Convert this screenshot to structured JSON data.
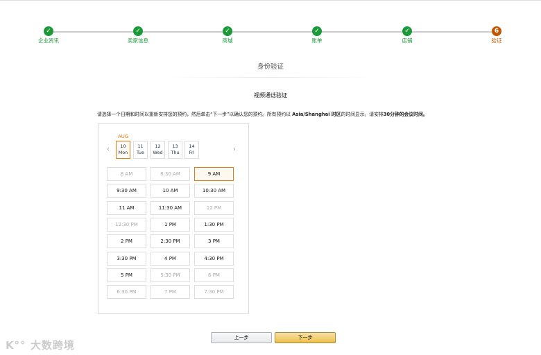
{
  "steps": [
    {
      "label": "企业资讯",
      "done": true
    },
    {
      "label": "卖家信息",
      "done": true
    },
    {
      "label": "商城",
      "done": true
    },
    {
      "label": "账单",
      "done": true
    },
    {
      "label": "店铺",
      "done": true
    },
    {
      "label": "验证",
      "number": "6",
      "done": false
    }
  ],
  "check": "✓",
  "title": "身份验证",
  "subtitle": "视频通话验证",
  "instruction": {
    "part1": "请选择一个日期和时间以重新安排您的预约，然后单击“下一步”以确认您的预约。所有预约以 ",
    "tz": "Asia/Shanghai 时区",
    "part2": "的时间显示。请安排",
    "dur": "30分钟的会议时间。"
  },
  "calendar": {
    "month": "AUG",
    "prev": "‹",
    "next": "›",
    "dates": [
      {
        "day": "10",
        "wd": "Mon",
        "selected": true
      },
      {
        "day": "11",
        "wd": "Tue"
      },
      {
        "day": "12",
        "wd": "Wed"
      },
      {
        "day": "13",
        "wd": "Thu"
      },
      {
        "day": "14",
        "wd": "Fri"
      }
    ],
    "slots": [
      {
        "t": "8 AM",
        "s": "dis"
      },
      {
        "t": "8:30 AM",
        "s": "dis"
      },
      {
        "t": "9 AM",
        "s": "sel"
      },
      {
        "t": "9:30 AM",
        "s": ""
      },
      {
        "t": "10 AM",
        "s": ""
      },
      {
        "t": "10:30 AM",
        "s": ""
      },
      {
        "t": "11 AM",
        "s": ""
      },
      {
        "t": "11:30 AM",
        "s": ""
      },
      {
        "t": "12 PM",
        "s": "dis"
      },
      {
        "t": "12:30 PM",
        "s": "dis"
      },
      {
        "t": "1 PM",
        "s": ""
      },
      {
        "t": "1:30 PM",
        "s": ""
      },
      {
        "t": "2 PM",
        "s": ""
      },
      {
        "t": "2:30 PM",
        "s": ""
      },
      {
        "t": "3 PM",
        "s": ""
      },
      {
        "t": "3:30 PM",
        "s": ""
      },
      {
        "t": "4 PM",
        "s": ""
      },
      {
        "t": "4:30 PM",
        "s": ""
      },
      {
        "t": "5 PM",
        "s": ""
      },
      {
        "t": "5:30 PM",
        "s": "dis"
      },
      {
        "t": "6 PM",
        "s": "dis"
      },
      {
        "t": "6:30 PM",
        "s": "dis"
      },
      {
        "t": "7 PM",
        "s": "dis"
      },
      {
        "t": "7:30 PM",
        "s": "dis"
      }
    ]
  },
  "buttons": {
    "prev": "上一步",
    "next": "下一步"
  },
  "watermark": "大数跨境"
}
